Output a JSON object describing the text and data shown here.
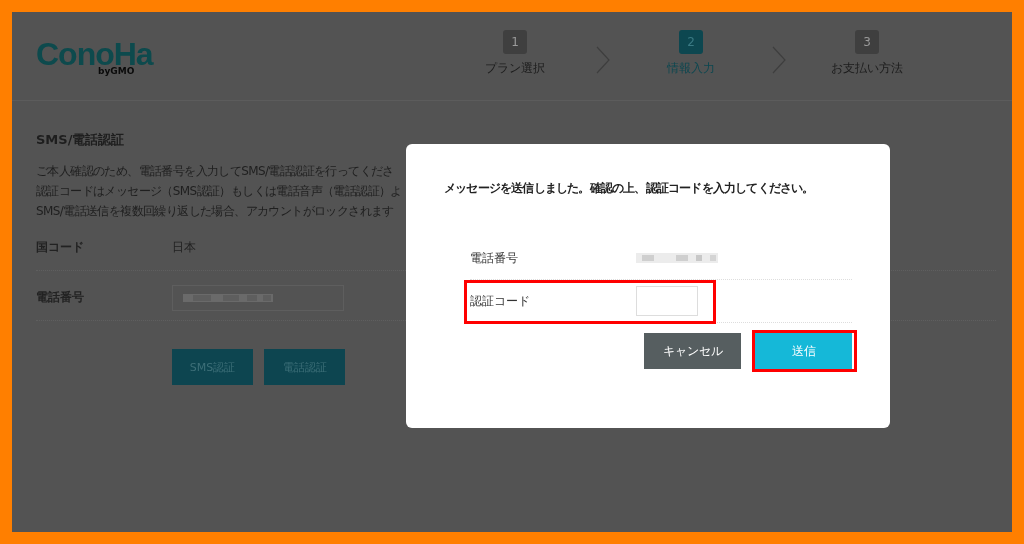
{
  "header": {
    "logo": "ConoHa",
    "logo_sub": "byGMO",
    "steps": [
      {
        "number": "1",
        "label": "プラン選択",
        "selected": false
      },
      {
        "number": "2",
        "label": "情報入力",
        "selected": true
      },
      {
        "number": "3",
        "label": "お支払い方法",
        "selected": false
      }
    ]
  },
  "section": {
    "title": "SMS/電話認証",
    "lines": [
      "ご本人確認のため、電話番号を入力してSMS/電話認証を行ってくださ",
      "認証コードはメッセージ（SMS認証）もしくは電話音声（電話認証）よ",
      "SMS/電話送信を複数回繰り返した場合、アカウントがロックされます"
    ],
    "rows": [
      {
        "label": "国コード",
        "kind": "text",
        "value": "日本"
      },
      {
        "label": "電話番号",
        "kind": "input"
      }
    ],
    "buttons": [
      "SMS認証",
      "電話認証"
    ]
  },
  "dialog": {
    "message": "メッセージを送信しました。確認の上、認証コードを入力してください。",
    "rows": [
      {
        "label": "電話番号",
        "kind": "text"
      },
      {
        "label": "認証コード",
        "kind": "input"
      }
    ],
    "buttons": [
      {
        "label": "キャンセル",
        "kind": "secondary"
      },
      {
        "label": "送信",
        "kind": "primary"
      }
    ]
  }
}
